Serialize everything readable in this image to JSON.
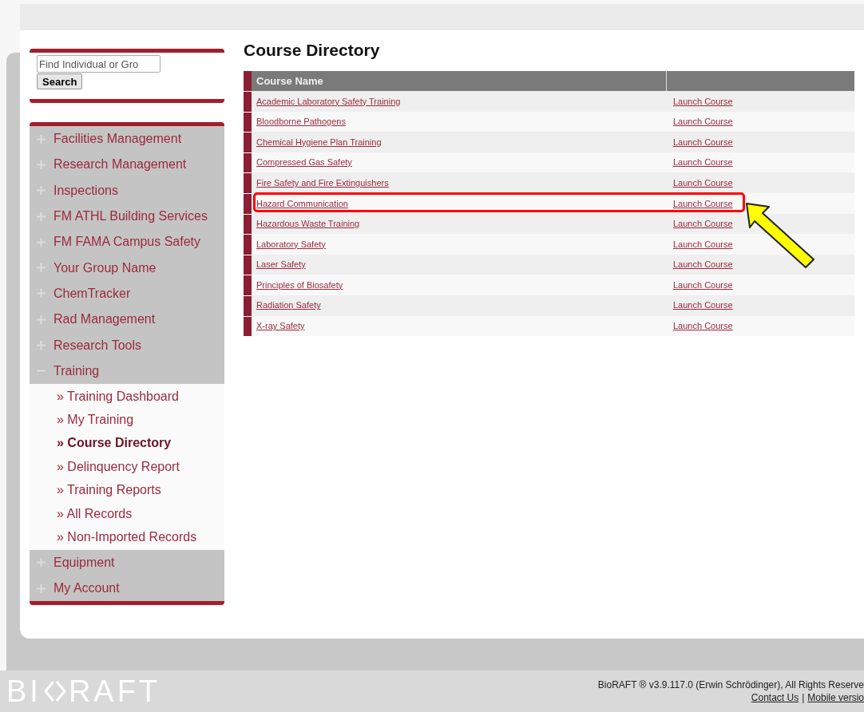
{
  "search": {
    "placeholder": "Find Individual or Gro",
    "button": "Search"
  },
  "nav": [
    {
      "label": "Facilities Management",
      "expanded": false
    },
    {
      "label": "Research Management",
      "expanded": false
    },
    {
      "label": "Inspections",
      "expanded": false
    },
    {
      "label": "FM ATHL Building Services",
      "expanded": false
    },
    {
      "label": "FM FAMA Campus Safety",
      "expanded": false
    },
    {
      "label": "Your Group Name",
      "expanded": false
    },
    {
      "label": "ChemTracker",
      "expanded": false
    },
    {
      "label": "Rad Management",
      "expanded": false
    },
    {
      "label": "Research Tools",
      "expanded": false
    },
    {
      "label": "Training",
      "expanded": true,
      "children": [
        {
          "label": "» Training Dashboard",
          "selected": false
        },
        {
          "label": "» My Training",
          "selected": false
        },
        {
          "label": "» Course Directory",
          "selected": true
        },
        {
          "label": "» Delinquency Report",
          "selected": false
        },
        {
          "label": "» Training Reports",
          "selected": false
        },
        {
          "label": "» All Records",
          "selected": false
        },
        {
          "label": "» Non-Imported Records",
          "selected": false
        }
      ]
    },
    {
      "label": "Equipment",
      "expanded": false
    },
    {
      "label": "My Account",
      "expanded": false
    }
  ],
  "page_title": "Course Directory",
  "table": {
    "columns": [
      "Course Name"
    ],
    "rows": [
      {
        "name": "Academic Laboratory Safety Training",
        "action": "Launch Course",
        "highlighted": false
      },
      {
        "name": "Bloodborne Pathogens",
        "action": "Launch Course",
        "highlighted": false
      },
      {
        "name": "Chemical Hygiene Plan Training",
        "action": "Launch Course",
        "highlighted": false
      },
      {
        "name": "Compressed Gas Safety",
        "action": "Launch Course",
        "highlighted": false
      },
      {
        "name": "Fire Safety and Fire Extinguishers",
        "action": "Launch Course",
        "highlighted": false
      },
      {
        "name": "Hazard Communication",
        "action": "Launch Course",
        "highlighted": true
      },
      {
        "name": "Hazardous Waste Training",
        "action": "Launch Course",
        "highlighted": false
      },
      {
        "name": "Laboratory Safety",
        "action": "Launch Course",
        "highlighted": false
      },
      {
        "name": "Laser Safety",
        "action": "Launch Course",
        "highlighted": false
      },
      {
        "name": "Principles of Biosafety",
        "action": "Launch Course",
        "highlighted": false
      },
      {
        "name": "Radiation Safety",
        "action": "Launch Course",
        "highlighted": false
      },
      {
        "name": "X-ray Safety",
        "action": "Launch Course",
        "highlighted": false
      }
    ]
  },
  "footer": {
    "logo_left": "BI",
    "logo_right": "RAFT",
    "copyright": "BioRAFT ® v3.9.117.0 (Erwin Schrödinger), All Rights Reserve",
    "links": [
      "Contact Us",
      "Mobile versio"
    ],
    "separator": "|"
  }
}
